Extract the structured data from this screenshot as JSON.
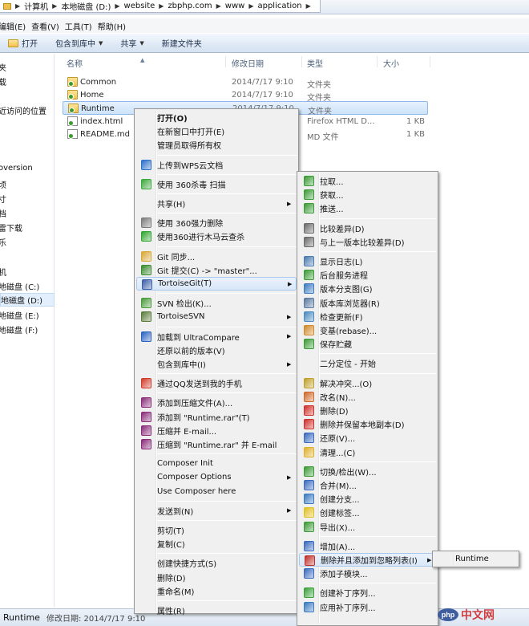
{
  "address": {
    "crumbs": [
      "计算机",
      "本地磁盘 (D:)",
      "website",
      "zbphp.com",
      "www",
      "application"
    ]
  },
  "menubar": [
    "编辑(E)",
    "查看(V)",
    "工具(T)",
    "帮助(H)"
  ],
  "toolbar": {
    "open": "打开",
    "include": "包含到库中",
    "share": "共享",
    "new_folder": "新建文件夹"
  },
  "nav": [
    "夹",
    "载",
    "近访问的位置",
    "oversion",
    "顷",
    "寸",
    "档",
    "雷下载",
    "乐",
    "机",
    "地磁盘 (C:)",
    "地磁盘 (D:)",
    "地磁盘 (E:)",
    "地磁盘 (F:)"
  ],
  "columns": {
    "name": "名称",
    "date": "修改日期",
    "type": "类型",
    "size": "大小"
  },
  "files": [
    {
      "name": "Common",
      "date": "2014/7/17 9:10",
      "type": "文件夹",
      "size": "",
      "kind": "folder"
    },
    {
      "name": "Home",
      "date": "2014/7/17 9:10",
      "type": "文件夹",
      "size": "",
      "kind": "folder"
    },
    {
      "name": "Runtime",
      "date": "2014/7/17 9:10",
      "type": "文件夹",
      "size": "",
      "kind": "folder"
    },
    {
      "name": "index.html",
      "date": "",
      "type": "Firefox HTML D...",
      "size": "1 KB",
      "kind": "html"
    },
    {
      "name": "README.md",
      "date": "",
      "type": "MD 文件",
      "size": "1 KB",
      "kind": "md"
    }
  ],
  "context_menu": [
    {
      "label": "打开(O)",
      "bold": true
    },
    {
      "label": "在新窗口中打开(E)"
    },
    {
      "label": "管理员取得所有权"
    },
    {
      "sep": true
    },
    {
      "label": "上传到WPS云文档",
      "icon": "wps-cloud-icon"
    },
    {
      "sep": true
    },
    {
      "label": "使用 360杀毒 扫描",
      "icon": "360-shield-icon"
    },
    {
      "sep": true
    },
    {
      "label": "共享(H)",
      "sub": true
    },
    {
      "sep": true
    },
    {
      "label": "使用 360强力删除",
      "icon": "shredder-icon"
    },
    {
      "label": "使用360进行木马云查杀",
      "icon": "360-scan-icon"
    },
    {
      "sep": true
    },
    {
      "label": "Git 同步...",
      "icon": "git-sync-icon"
    },
    {
      "label": "Git 提交(C) -> \"master\"...",
      "icon": "git-commit-icon"
    },
    {
      "label": "TortoiseGit(T)",
      "icon": "tortoisegit-icon",
      "sub": true,
      "hl": true
    },
    {
      "sep": true
    },
    {
      "label": "SVN 检出(K)...",
      "icon": "svn-checkout-icon"
    },
    {
      "label": "TortoiseSVN",
      "icon": "tortoisesvn-icon",
      "sub": true
    },
    {
      "sep": true
    },
    {
      "label": "加载到 UltraCompare",
      "icon": "ultracompare-icon",
      "sub": true
    },
    {
      "label": "还原以前的版本(V)"
    },
    {
      "label": "包含到库中(I)",
      "sub": true
    },
    {
      "sep": true
    },
    {
      "label": "通过QQ发送到我的手机",
      "icon": "qq-icon"
    },
    {
      "sep": true
    },
    {
      "label": "添加到压缩文件(A)...",
      "icon": "winrar-icon"
    },
    {
      "label": "添加到 \"Runtime.rar\"(T)",
      "icon": "winrar-icon"
    },
    {
      "label": "压缩并 E-mail...",
      "icon": "winrar-icon"
    },
    {
      "label": "压缩到 \"Runtime.rar\" 并 E-mail",
      "icon": "winrar-icon"
    },
    {
      "sep": true
    },
    {
      "label": "Composer Init"
    },
    {
      "label": "Composer Options",
      "sub": true
    },
    {
      "label": "Use Composer here"
    },
    {
      "sep": true
    },
    {
      "label": "发送到(N)",
      "sub": true
    },
    {
      "sep": true
    },
    {
      "label": "剪切(T)"
    },
    {
      "label": "复制(C)"
    },
    {
      "sep": true
    },
    {
      "label": "创建快捷方式(S)"
    },
    {
      "label": "删除(D)"
    },
    {
      "label": "重命名(M)"
    },
    {
      "sep": true
    },
    {
      "label": "属性(R)"
    }
  ],
  "git_menu": [
    {
      "label": "拉取...",
      "icon": "git-pull-icon"
    },
    {
      "label": "获取...",
      "icon": "git-fetch-icon"
    },
    {
      "label": "推送...",
      "icon": "git-push-icon"
    },
    {
      "sep": true
    },
    {
      "label": "比较差异(D)",
      "icon": "diff-icon"
    },
    {
      "label": "与上一版本比较差异(D)",
      "icon": "diff-prev-icon"
    },
    {
      "sep": true
    },
    {
      "label": "显示日志(L)",
      "icon": "log-icon"
    },
    {
      "label": "后台服务进程",
      "icon": "daemon-icon"
    },
    {
      "label": "版本分支图(G)",
      "icon": "revgraph-icon"
    },
    {
      "label": "版本库浏览器(R)",
      "icon": "repo-browser-icon"
    },
    {
      "label": "检查更新(F)",
      "icon": "check-mods-icon"
    },
    {
      "label": "变基(rebase)...",
      "icon": "rebase-icon"
    },
    {
      "label": "保存贮藏",
      "icon": "stash-icon"
    },
    {
      "sep": true
    },
    {
      "label": "二分定位 - 开始"
    },
    {
      "sep": true
    },
    {
      "label": "解决冲突...(O)",
      "icon": "resolve-icon"
    },
    {
      "label": "改名(N)...",
      "icon": "rename-icon"
    },
    {
      "label": "删除(D)",
      "icon": "delete-icon"
    },
    {
      "label": "删除并保留本地副本(D)",
      "icon": "delete-keep-icon"
    },
    {
      "label": "还原(V)...",
      "icon": "revert-icon"
    },
    {
      "label": "清理...(C)",
      "icon": "cleanup-icon"
    },
    {
      "sep": true
    },
    {
      "label": "切换/检出(W)...",
      "icon": "switch-icon"
    },
    {
      "label": "合并(M)...",
      "icon": "merge-icon"
    },
    {
      "label": "创建分支...",
      "icon": "branch-icon"
    },
    {
      "label": "创建标签...",
      "icon": "tag-icon"
    },
    {
      "label": "导出(X)...",
      "icon": "export-icon"
    },
    {
      "sep": true
    },
    {
      "label": "增加(A)...",
      "icon": "add-icon"
    },
    {
      "label": "删除并且添加到忽略列表(I)",
      "icon": "ignore-icon",
      "sub": true,
      "hl": true
    },
    {
      "label": "添加子模块...",
      "icon": "submodule-icon"
    },
    {
      "sep": true
    },
    {
      "label": "创建补丁序列...",
      "icon": "create-patch-icon"
    },
    {
      "label": "应用补丁序列...",
      "icon": "apply-patch-icon"
    }
  ],
  "ignore_menu": [
    {
      "label": "Runtime"
    }
  ],
  "status": {
    "name": "Runtime",
    "meta": "修改日期: 2014/7/17 9:10"
  },
  "watermark": {
    "logo": "php",
    "text": "中文网"
  }
}
